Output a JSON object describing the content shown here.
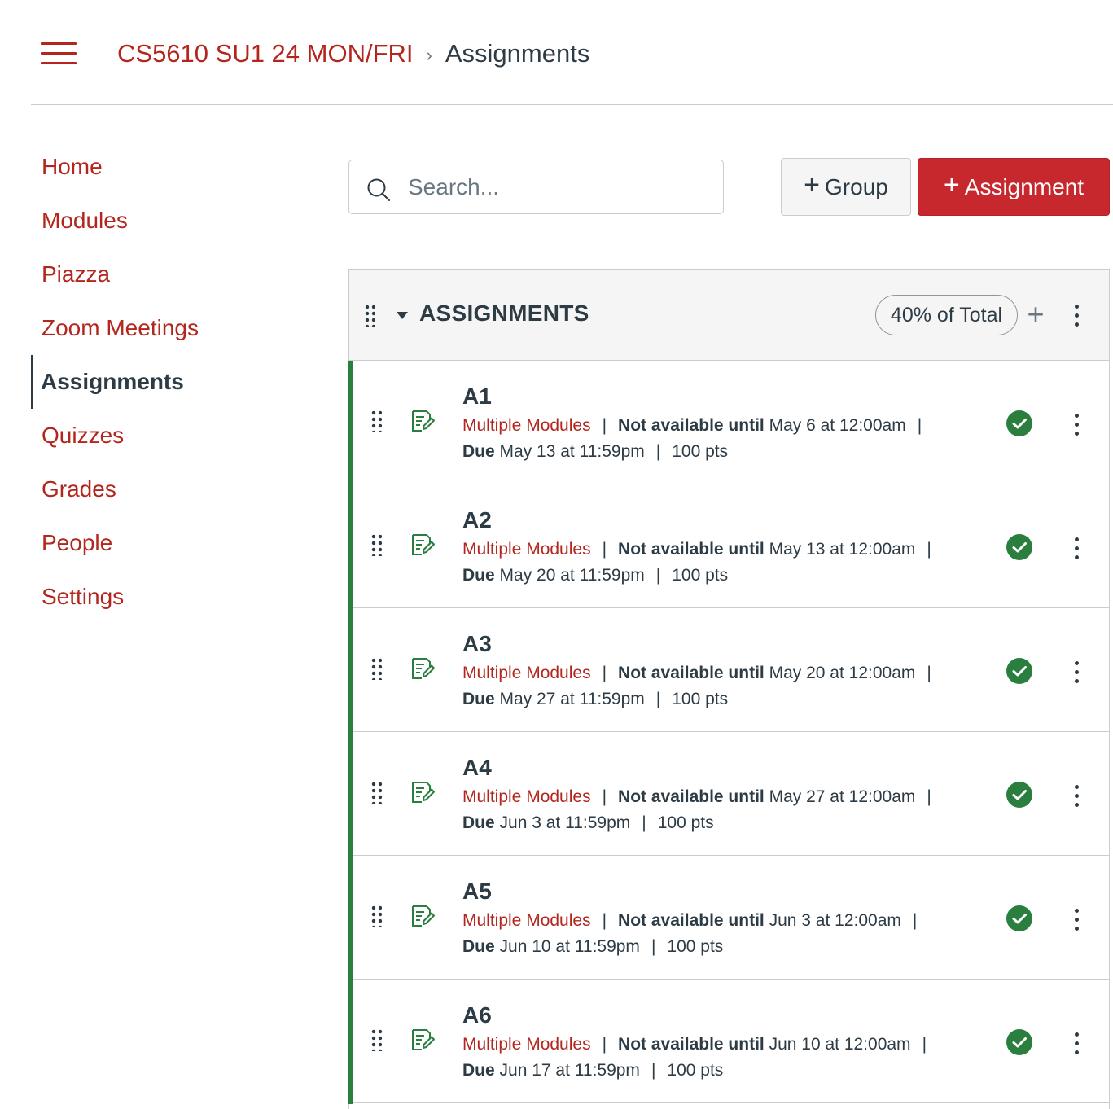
{
  "header": {
    "course": "CS5610 SU1 24 MON/FRI",
    "separator": "›",
    "current": "Assignments"
  },
  "sidebar": {
    "items": [
      {
        "label": "Home"
      },
      {
        "label": "Modules"
      },
      {
        "label": "Piazza"
      },
      {
        "label": "Zoom Meetings"
      },
      {
        "label": "Assignments",
        "active": true
      },
      {
        "label": "Quizzes"
      },
      {
        "label": "Grades"
      },
      {
        "label": "People"
      },
      {
        "label": "Settings"
      }
    ]
  },
  "toolbar": {
    "search_placeholder": "Search...",
    "search_value": "",
    "group_button_label": "Group",
    "assignment_button_label": "Assignment",
    "plus": "+"
  },
  "group": {
    "title": "ASSIGNMENTS",
    "weight": "40% of Total",
    "add": "+"
  },
  "labels": {
    "not_available_until": "Not available until",
    "due": "Due",
    "pipe": "|"
  },
  "assignments": [
    {
      "title": "A1",
      "modules": "Multiple Modules",
      "available": "May 6 at 12:00am",
      "due": "May 13 at 11:59pm",
      "points": "100 pts"
    },
    {
      "title": "A2",
      "modules": "Multiple Modules",
      "available": "May 13 at 12:00am",
      "due": "May 20 at 11:59pm",
      "points": "100 pts"
    },
    {
      "title": "A3",
      "modules": "Multiple Modules",
      "available": "May 20 at 12:00am",
      "due": "May 27 at 11:59pm",
      "points": "100 pts"
    },
    {
      "title": "A4",
      "modules": "Multiple Modules",
      "available": "May 27 at 12:00am",
      "due": "Jun 3 at 11:59pm",
      "points": "100 pts"
    },
    {
      "title": "A5",
      "modules": "Multiple Modules",
      "available": "Jun 3 at 12:00am",
      "due": "Jun 10 at 11:59pm",
      "points": "100 pts"
    },
    {
      "title": "A6",
      "modules": "Multiple Modules",
      "available": "Jun 10 at 12:00am",
      "due": "Jun 17 at 11:59pm",
      "points": "100 pts"
    }
  ],
  "colors": {
    "brand": "#b3261e",
    "primary_button": "#c7282d",
    "published": "#2a7f3e",
    "text": "#2d3b45"
  },
  "icons": {
    "menu": "hamburger-icon",
    "search": "search-icon",
    "drag": "drag-handle-icon",
    "collapse": "caret-down-icon",
    "assignment": "assignment-icon",
    "published": "check-circle-icon",
    "more": "kebab-icon",
    "add": "plus-icon"
  }
}
